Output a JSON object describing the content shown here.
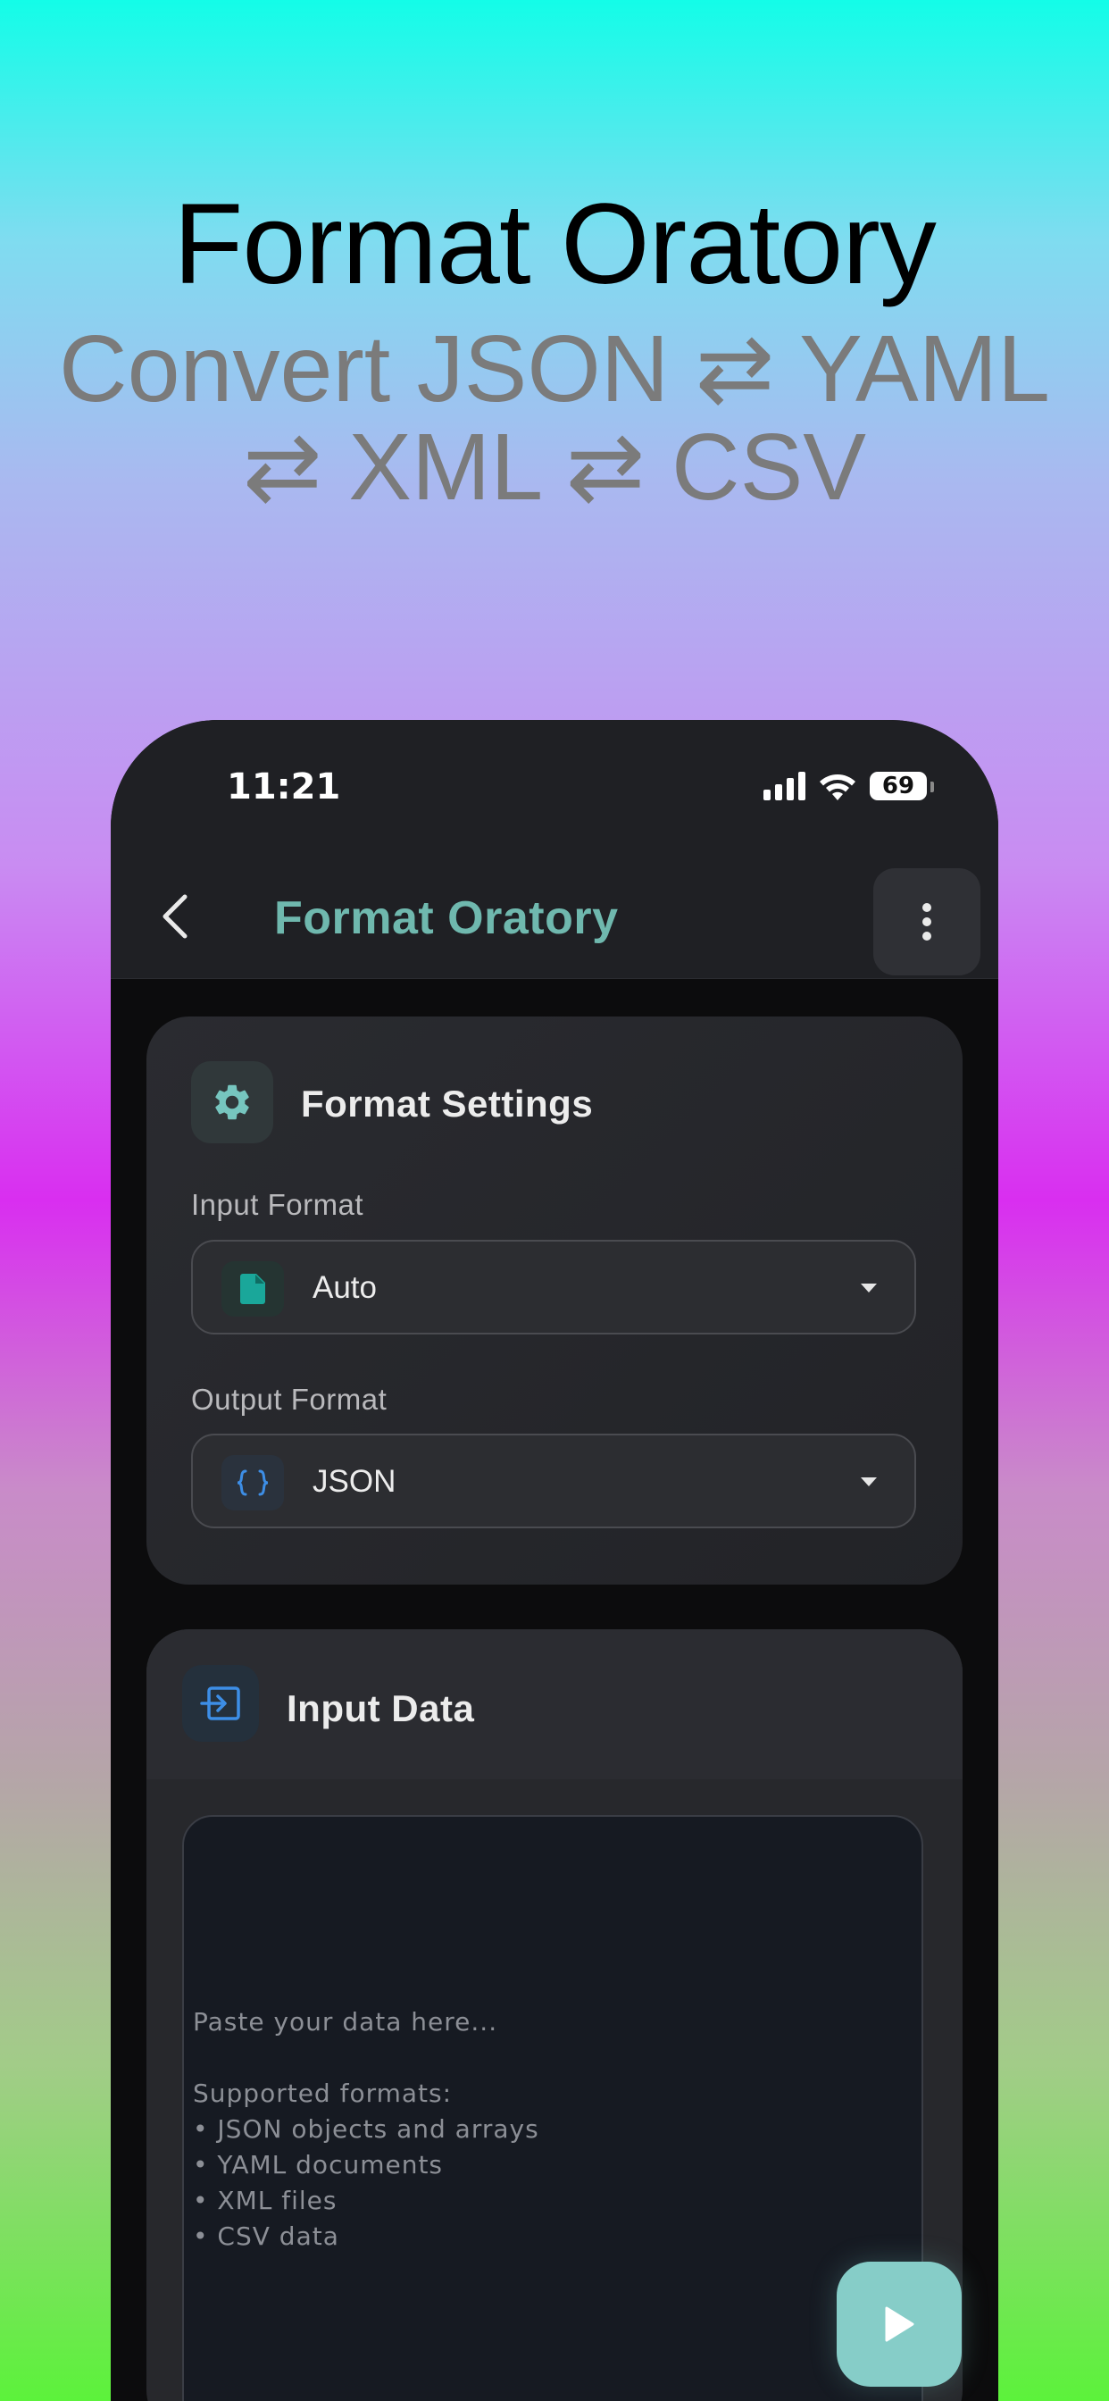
{
  "promo": {
    "headline": "Format Oratory",
    "subline": "Convert JSON ⇄ YAML ⇄ XML ⇄ CSV"
  },
  "status_bar": {
    "time": "11:21",
    "battery": "69"
  },
  "app_bar": {
    "title": "Format Oratory"
  },
  "settings_card": {
    "title": "Format Settings",
    "input_label": "Input Format",
    "input_value": "Auto",
    "output_label": "Output Format",
    "output_value": "JSON"
  },
  "input_card": {
    "title": "Input Data",
    "placeholder": "Paste your data here...\n\nSupported formats:\n• JSON objects and arrays\n• YAML documents\n• XML files\n• CSV data"
  },
  "colors": {
    "accent": "#6fb8ae",
    "fab": "#86cdc8",
    "json_icon": "#3d8ee6",
    "file_icon": "#1aa79a"
  },
  "icons": {
    "back": "chevron-left-icon",
    "menu": "more-vertical-icon",
    "settings": "gear-icon",
    "input_format": "file-icon",
    "output_format": "braces-icon",
    "input_data": "input-icon",
    "run": "play-icon"
  }
}
